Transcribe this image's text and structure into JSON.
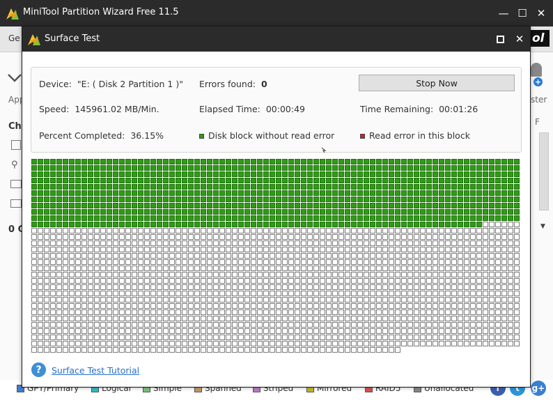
{
  "main_window": {
    "title": "MiniTool Partition Wizard Free 11.5",
    "controls": [
      "—",
      "☐",
      "✕"
    ],
    "menu_fragment": "Ge",
    "brand_fragment": "ol",
    "left_fragments": [
      "App",
      "Che",
      "0 C"
    ],
    "right_fragments": [
      "ster",
      "F"
    ]
  },
  "legend": [
    {
      "label": "GPT/Primary",
      "color": "#3d7fd4"
    },
    {
      "label": "Logical",
      "color": "#2ec0c8"
    },
    {
      "label": "Simple",
      "color": "#7bc47b"
    },
    {
      "label": "Spanned",
      "color": "#c89a6a"
    },
    {
      "label": "Striped",
      "color": "#c07ad0"
    },
    {
      "label": "Mirrored",
      "color": "#c8b82a"
    },
    {
      "label": "RAID5",
      "color": "#e05050"
    },
    {
      "label": "Unallocated",
      "color": "#8a8a8a"
    }
  ],
  "social": [
    {
      "icon": "facebook-icon",
      "glyph": "f",
      "color": "#3b5fb0"
    },
    {
      "icon": "twitter-icon",
      "glyph": "t",
      "color": "#2a96d8"
    },
    {
      "icon": "googleplus-icon",
      "glyph": "g+",
      "color": "#3b7fd0"
    }
  ],
  "dialog": {
    "title": "Surface Test",
    "device_label": "Device:",
    "device_value": "\"E: ( Disk 2 Partition 1 )\"",
    "errors_label": "Errors found:",
    "errors_value": "0",
    "stop_button": "Stop Now",
    "speed_label": "Speed:",
    "speed_value": "145961.02 MB/Min.",
    "elapsed_label": "Elapsed Time:",
    "elapsed_value": "00:00:49",
    "remaining_label": "Time Remaining:",
    "remaining_value": "00:01:26",
    "percent_label": "Percent Completed:",
    "percent_value": "36.15%",
    "legend_ok": "Disk block without read error",
    "legend_ok_color": "#2f9c15",
    "legend_err": "Read error in this block",
    "legend_err_color": "#d41e1e",
    "tutorial_link": "Surface Test Tutorial"
  },
  "block_grid": {
    "columns": 78,
    "rows": 31,
    "completed_blocks": 852,
    "total_blocks": 2399
  }
}
